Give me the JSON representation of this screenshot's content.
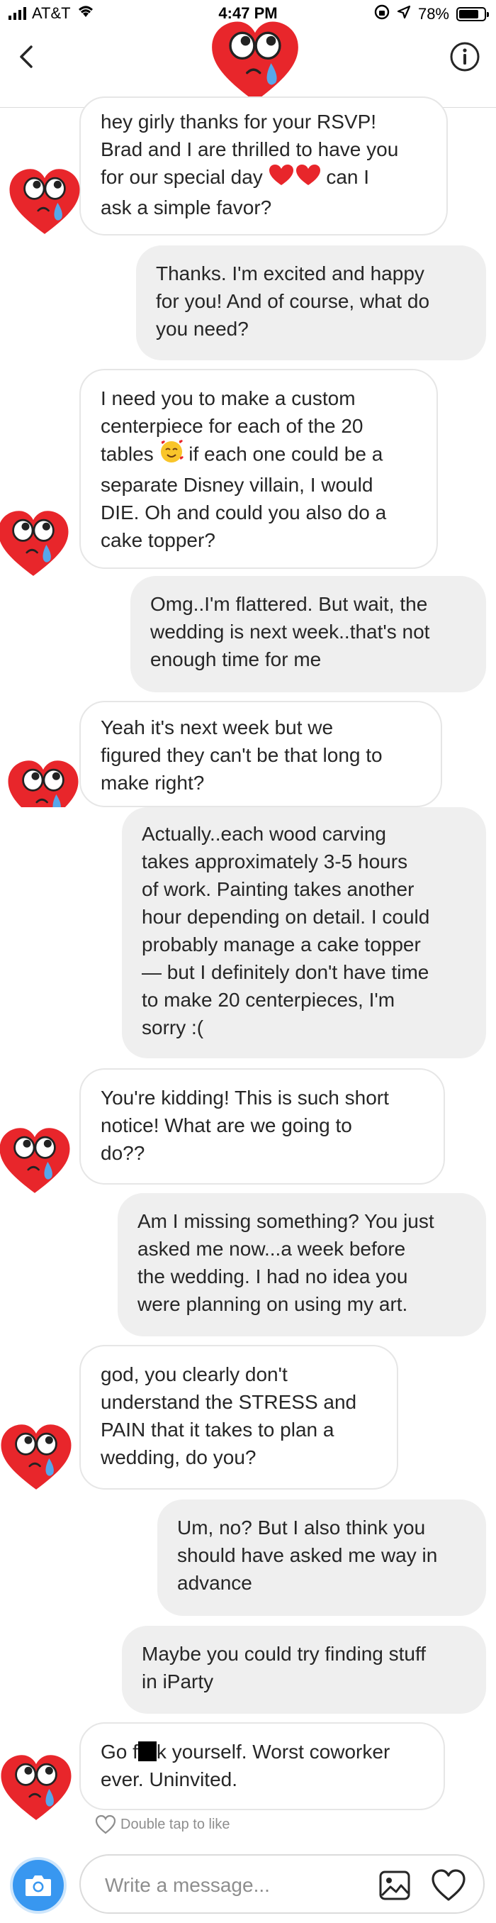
{
  "status_bar": {
    "carrier": "AT&T",
    "time": "4:47 PM",
    "battery": "78%",
    "battery_level": 0.78
  },
  "header": {
    "back_icon": "chevron-left-icon",
    "info_icon": "info-icon",
    "avatar_icon": "crying-heart-icon"
  },
  "messages": [
    {
      "from": "them",
      "text_before": "hey girly thanks for your RSVP!\nBrad and I are thrilled to have you\nfor our special day ",
      "text_after": " can I\nask a simple favor?",
      "emoji": "red-hearts-emoji"
    },
    {
      "from": "me",
      "text": "Thanks. I'm excited and happy\nfor you! And of course, what do\nyou need?"
    },
    {
      "from": "them",
      "text_before": "I need you to make a custom\ncenterpiece for each of the 20\ntables ",
      "text_after": " if each one could be a\nseparate Disney villain, I would\nDIE. Oh and could you also do a\ncake topper?",
      "emoji": "smiling-face-with-hearts-emoji"
    },
    {
      "from": "me",
      "text": "Omg..I'm flattered. But wait, the\nwedding is next week..that's not\nenough time for me"
    },
    {
      "from": "them",
      "text": "Yeah it's next week but we\nfigured they can't be that long to\nmake right?"
    },
    {
      "from": "me",
      "text": "Actually..each wood carving\ntakes approximately 3-5 hours\nof work. Painting takes another\nhour depending on detail. I could\nprobably manage a cake topper\n— but I definitely don't have time\nto make 20 centerpieces, I'm\nsorry :("
    },
    {
      "from": "them",
      "text": "You're kidding! This is such short\nnotice! What are we going to\ndo??"
    },
    {
      "from": "me",
      "text": "Am I missing something? You just\nasked me now...a week before\nthe wedding. I had no idea you\nwere planning on using my art."
    },
    {
      "from": "them",
      "text": "god, you clearly don't\nunderstand the STRESS and\nPAIN that it takes to plan a\nwedding, do you?"
    },
    {
      "from": "me",
      "text": "Um, no? But I also think you\nshould have asked me way in\nadvance"
    },
    {
      "from": "me",
      "text": "Maybe you could try finding stuff\nin iParty"
    },
    {
      "from": "them",
      "text_before": "Go f",
      "text_after": "k yourself. Worst coworker\never. Uninvited.",
      "redacted": true
    }
  ],
  "like_hint": "Double tap to like",
  "composer": {
    "placeholder": "Write a message...",
    "camera_icon": "camera-icon",
    "gallery_icon": "image-icon",
    "like_icon": "heart-icon"
  },
  "colors": {
    "accent_blue": "#3897f0",
    "incoming_bubble": "#ffffff",
    "outgoing_bubble": "#efefef",
    "heart_red": "#e8262b",
    "tear_blue": "#57a7ea"
  }
}
